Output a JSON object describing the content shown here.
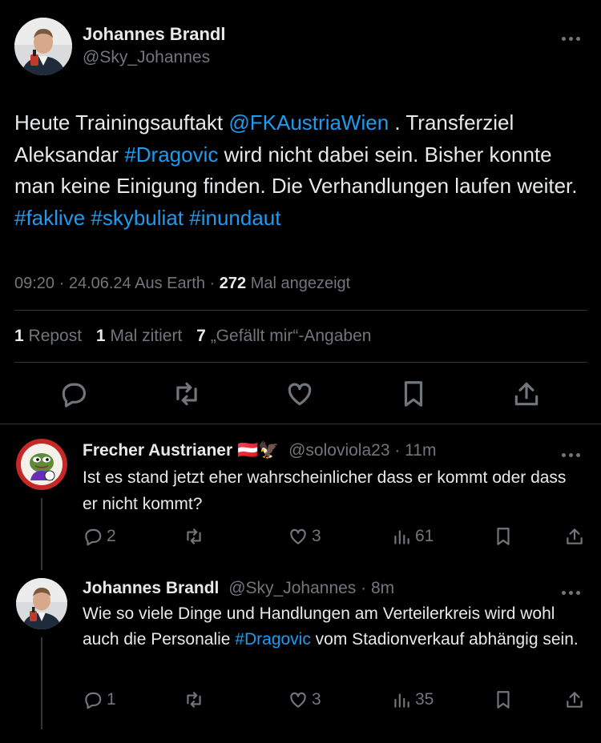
{
  "main_tweet": {
    "author_name": "Johannes Brandl",
    "author_handle": "@Sky_Johannes",
    "text_parts": [
      {
        "t": "Heute Trainingsauftakt ",
        "link": false
      },
      {
        "t": "@FKAustriaWien",
        "link": true
      },
      {
        "t": " . Transferziel Aleksandar ",
        "link": false
      },
      {
        "t": "#Dragovic",
        "link": true
      },
      {
        "t": " wird nicht dabei sein. Bisher konnte man keine Einigung finden. Die Verhandlungen laufen weiter. ",
        "link": false
      },
      {
        "t": "#faklive",
        "link": true
      },
      {
        "t": " ",
        "link": false
      },
      {
        "t": "#skybuliat",
        "link": true
      },
      {
        "t": " ",
        "link": false
      },
      {
        "t": "#inundaut",
        "link": true
      }
    ],
    "time": "09:20 · 24.06.24",
    "source": "Aus Earth",
    "separator": "·",
    "views_count": "272",
    "views_label": "Mal angezeigt",
    "reposts_count": "1",
    "reposts_label": "Repost",
    "quotes_count": "1",
    "quotes_label": "Mal zitiert",
    "likes_count": "7",
    "likes_label": "„Gefällt mir“-Angaben"
  },
  "replies": [
    {
      "author_name": "Frecher Austrianer 🇦🇹🦅",
      "author_handle": "@soloviola23",
      "time": "· 11m",
      "text": "Ist es stand jetzt eher wahrscheinlicher dass er kommt oder dass er nicht kommt?",
      "reply_count": "2",
      "repost_count": "",
      "like_count": "3",
      "view_count": "61"
    },
    {
      "author_name": "Johannes Brandl",
      "author_handle": "@Sky_Johannes",
      "time": "· 8m",
      "text_parts": [
        {
          "t": "Wie so viele Dinge und Handlungen am Verteilerkreis wird wohl auch die Personalie ",
          "link": false
        },
        {
          "t": "#Dragovic",
          "link": true
        },
        {
          "t": " vom Stadionverkauf abhängig sein.",
          "link": false
        }
      ],
      "reply_count": "1",
      "repost_count": "",
      "like_count": "3",
      "view_count": "35"
    }
  ],
  "colors": {
    "background": "#000000",
    "text": "#e7e9ea",
    "muted": "#71767b",
    "link": "#1d9bf0",
    "divider": "#2f3336"
  }
}
